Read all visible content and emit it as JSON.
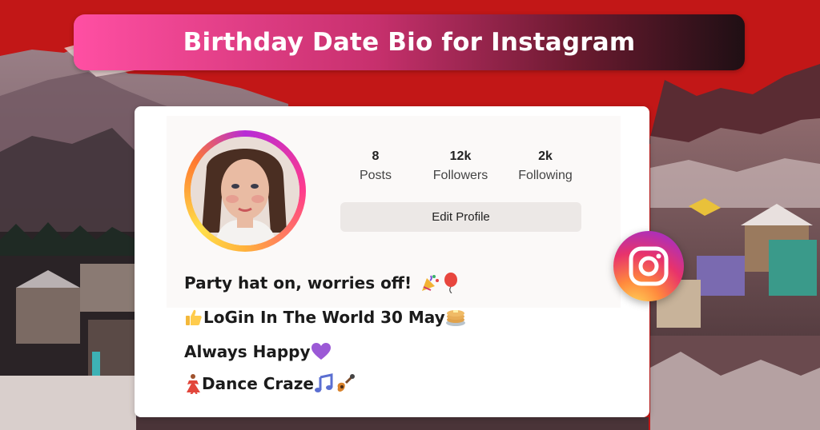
{
  "title": "Birthday Date Bio for Instagram",
  "profile": {
    "stats": [
      {
        "value": "8",
        "label": "Posts"
      },
      {
        "value": "12k",
        "label": "Followers"
      },
      {
        "value": "2k",
        "label": "Following"
      }
    ],
    "edit_label": "Edit Profile"
  },
  "bio": {
    "line1": "Party hat on, worries off!",
    "line2": "LoGin In The World 30 May",
    "line3": "Always Happy",
    "line4": "Dance Craze"
  },
  "icons": [
    "party-popper-icon",
    "balloon-icon",
    "thumbs-up-icon",
    "pancakes-icon",
    "purple-heart-icon",
    "dancer-icon",
    "music-notes-icon",
    "guitar-icon",
    "instagram-icon"
  ],
  "colors": {
    "background_red": "#c21717",
    "banner_start": "#ff4fa3",
    "banner_end": "#1f0f14"
  }
}
